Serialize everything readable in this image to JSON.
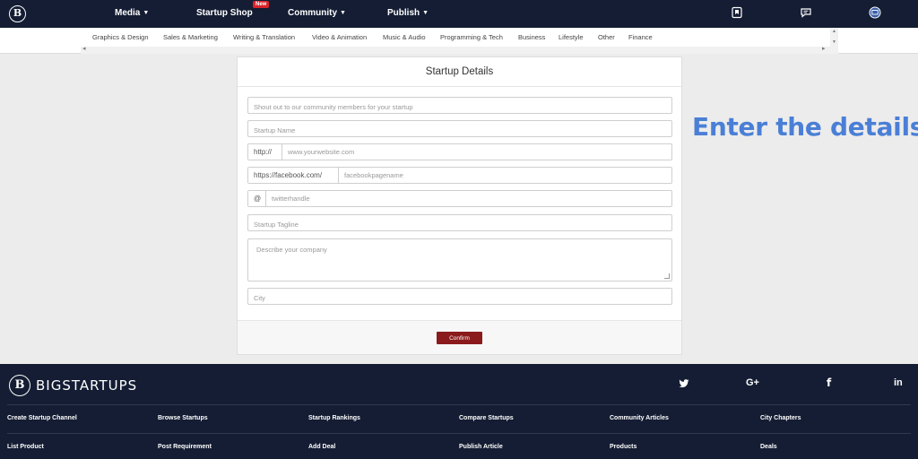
{
  "nav": {
    "logo": "B",
    "items": [
      {
        "label": "Media",
        "caret": true
      },
      {
        "label": "Startup Shop",
        "caret": false
      },
      {
        "label": "Community",
        "caret": true
      },
      {
        "label": "Publish",
        "caret": true
      }
    ],
    "new_badge": "New"
  },
  "categories": [
    "Graphics & Design",
    "Sales & Marketing",
    "Writing & Translation",
    "Video & Animation",
    "Music & Audio",
    "Programming & Tech",
    "Business",
    "Lifestyle",
    "Other",
    "Finance"
  ],
  "form": {
    "title": "Startup Details",
    "shoutout_placeholder": "Shout out to our community members for your startup",
    "name_placeholder": "Startup Name",
    "website_prefix": "http://",
    "website_placeholder": "www.yourwebsite.com",
    "facebook_prefix": "https://facebook.com/",
    "facebook_placeholder": "facebookpagename",
    "twitter_prefix": "@",
    "twitter_placeholder": "twitterhandle",
    "tagline_placeholder": "Startup Tagline",
    "description_placeholder": "Describe your company",
    "city_placeholder": "City",
    "confirm_label": "Confirm"
  },
  "annotation": "Enter the details",
  "footer": {
    "logo": "B",
    "brand": "BIGSTARTUPS",
    "social": [
      "twitter-icon",
      "google-plus-icon",
      "facebook-icon",
      "linkedin-icon"
    ],
    "links_row1": [
      "Create Startup Channel",
      "Browse Startups",
      "Startup Rankings",
      "Compare Startups",
      "Community Articles",
      "City Chapters"
    ],
    "links_row2": [
      "List Product",
      "Post Requirement",
      "Add Deal",
      "Publish Article",
      "Products",
      "Deals"
    ]
  }
}
